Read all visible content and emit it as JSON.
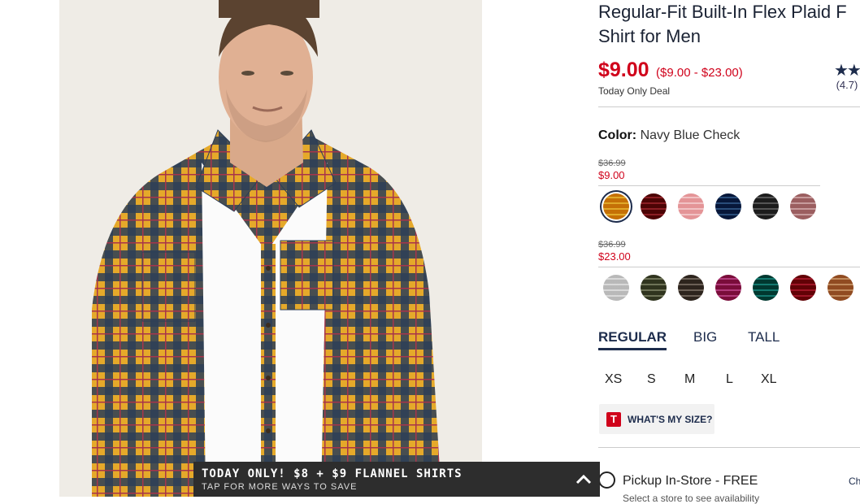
{
  "product": {
    "title_line1": "Regular-Fit Built-In Flex Plaid F",
    "title_line2": "Shirt for Men",
    "price_now": "$9.00",
    "price_range": "($9.00 - $23.00)",
    "deal_label": "Today Only Deal",
    "rating_stars": "★★",
    "rating_value": "(4.7)"
  },
  "color": {
    "label": "Color:",
    "value": "Navy Blue Check"
  },
  "price_groups": [
    {
      "was": "$36.99",
      "sale": "$9.00",
      "swatch_colors": [
        "#e0a92a",
        "#8b1e24",
        "#f1c2c4",
        "#2a4d7a",
        "#555555",
        "#c79b9c"
      ],
      "selected_index": 0
    },
    {
      "was": "$36.99",
      "sale": "$23.00",
      "swatch_colors": [
        "#d9d9d9",
        "#6e7357",
        "#6b6056",
        "#b03a7a",
        "#13786e",
        "#9e1626",
        "#c08a5c"
      ]
    }
  ],
  "fit_tabs": [
    {
      "label": "REGULAR",
      "active": true
    },
    {
      "label": "BIG",
      "active": false
    },
    {
      "label": "TALL",
      "active": false
    }
  ],
  "sizes": [
    "XS",
    "S",
    "M",
    "L",
    "XL"
  ],
  "size_help": {
    "icon_letter": "T",
    "label": "WHAT'S MY SIZE?"
  },
  "pickup": {
    "label": "Pickup In-Store - FREE",
    "change": "Ch",
    "sub": "Select a store to see availability"
  },
  "banner": {
    "headline": "TODAY ONLY! $8 + $9 FLANNEL SHIRTS",
    "subline": "TAP FOR MORE WAYS TO SAVE"
  },
  "colors": {
    "brand_navy": "#1d2c4c",
    "sale_red": "#d0021b",
    "banner_bg": "#2d2d2d"
  }
}
